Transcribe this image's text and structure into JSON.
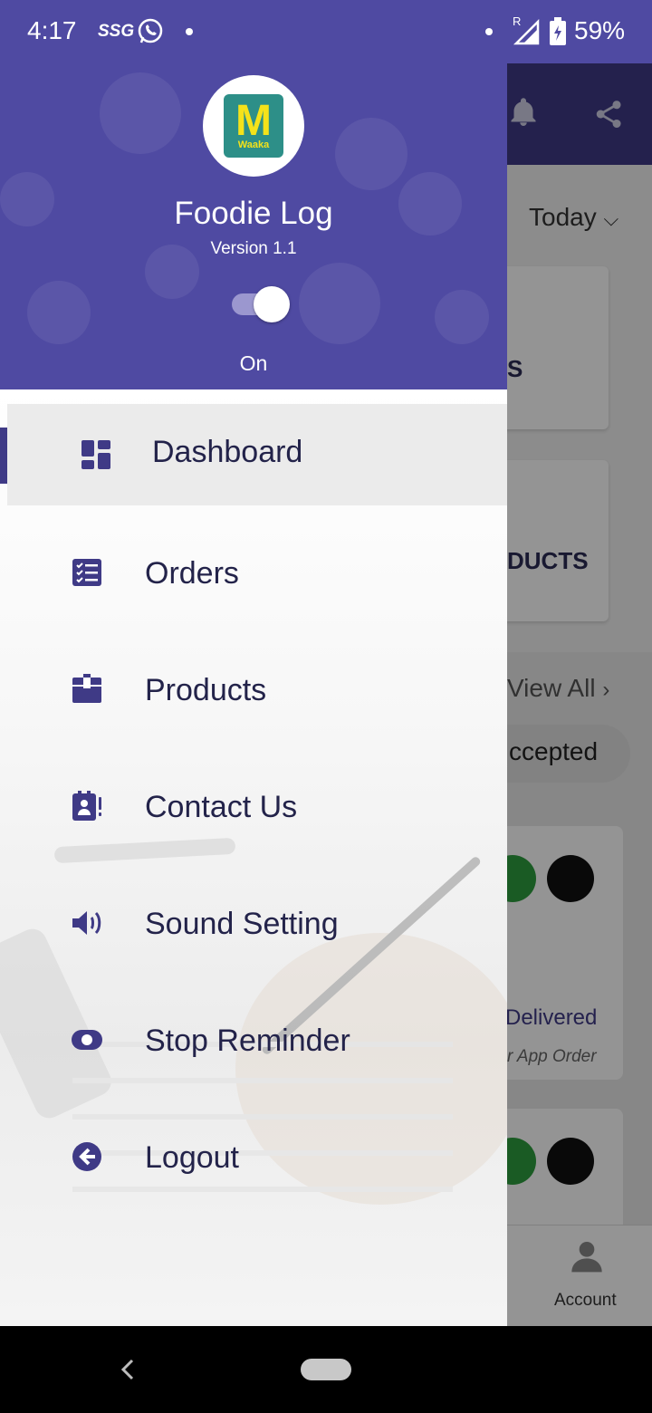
{
  "status_bar": {
    "time": "4:17",
    "carrier": "SSG",
    "battery": "59%",
    "signal_badge": "R"
  },
  "drawer": {
    "app_name": "Foodie Log",
    "version": "Version 1.1",
    "logo_letter": "M",
    "logo_text": "Waaka",
    "toggle_state": "On",
    "menu": [
      {
        "label": "Dashboard",
        "icon": "dashboard-icon",
        "active": true
      },
      {
        "label": "Orders",
        "icon": "orders-icon",
        "active": false
      },
      {
        "label": "Products",
        "icon": "products-icon",
        "active": false
      },
      {
        "label": "Contact Us",
        "icon": "contact-icon",
        "active": false
      },
      {
        "label": "Sound Setting",
        "icon": "sound-icon",
        "active": false
      },
      {
        "label": "Stop Reminder",
        "icon": "stop-reminder-icon",
        "active": false
      },
      {
        "label": "Logout",
        "icon": "logout-icon",
        "active": false
      }
    ]
  },
  "background": {
    "filter_label": "Today",
    "card_label_1": "S",
    "card_label_2": "DUCTS",
    "view_all": "View All",
    "status_pill": "ccepted",
    "order_status": "Delivered",
    "order_type": "r App Order",
    "bottom_nav_account": "Account"
  },
  "colors": {
    "primary": "#4f4aa2",
    "primary_dark": "#3f3a86",
    "menu_text": "#23234a"
  }
}
